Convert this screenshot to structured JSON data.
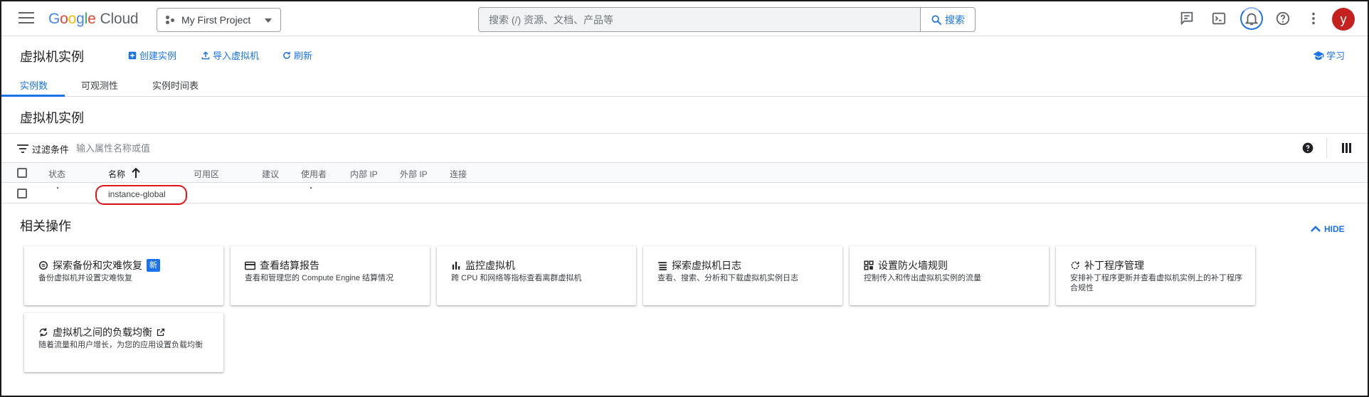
{
  "topbar": {
    "logo_letters": [
      "G",
      "o",
      "o",
      "g",
      "l",
      "e"
    ],
    "logo_suffix": "Cloud",
    "project_name": "My First Project",
    "search_placeholder": "搜索 (/) 资源、文档、产品等",
    "search_button": "搜索",
    "avatar_letter": "y"
  },
  "page_header": {
    "title": "虚拟机实例",
    "actions": {
      "create": "创建实例",
      "import": "导入虚拟机",
      "refresh": "刷新"
    },
    "learn": "学习"
  },
  "tabs": [
    {
      "label": "实例数",
      "active": true
    },
    {
      "label": "可观测性",
      "active": false
    },
    {
      "label": "实例时间表",
      "active": false
    }
  ],
  "instances_section": {
    "title": "虚拟机实例",
    "filter_label": "过滤条件",
    "filter_placeholder": "输入属性名称或值"
  },
  "table": {
    "columns": {
      "status": "状态",
      "name": "名称",
      "zone": "可用区",
      "recommendation": "建议",
      "in_use_by": "使用者",
      "internal_ip": "内部 IP",
      "external_ip": "外部 IP",
      "connect": "连接"
    },
    "sort_column": "name",
    "rows": [
      {
        "name": "instance-global"
      }
    ]
  },
  "related": {
    "title": "相关操作",
    "hide_label": "HIDE",
    "cards": [
      {
        "title": "探索备份和灾难恢复",
        "desc": "备份虚拟机并设置灾难恢复",
        "badge": "新",
        "icon": "backup-icon"
      },
      {
        "title": "查看结算报告",
        "desc": "查看和管理您的 Compute Engine 结算情况",
        "icon": "billing-icon"
      },
      {
        "title": "监控虚拟机",
        "desc": "跨 CPU 和网络等指标查看离群虚拟机",
        "icon": "monitoring-icon"
      },
      {
        "title": "探索虚拟机日志",
        "desc": "查看、搜索、分析和下载虚拟机实例日志",
        "icon": "logs-icon"
      },
      {
        "title": "设置防火墙规则",
        "desc": "控制传入和传出虚拟机实例的流量",
        "icon": "firewall-icon"
      },
      {
        "title": "补丁程序管理",
        "desc": "安排补丁程序更新并查看虚拟机实例上的补丁程序合规性",
        "icon": "patch-icon"
      },
      {
        "title": "虚拟机之间的负载均衡",
        "desc": "随着流量和用户增长，为您的应用设置负载均衡",
        "icon": "load-balancing-icon",
        "external": true
      }
    ]
  },
  "colors": {
    "accent": "#1a73e8",
    "highlight": "#e0151a",
    "avatar_bg": "#c5221f"
  }
}
